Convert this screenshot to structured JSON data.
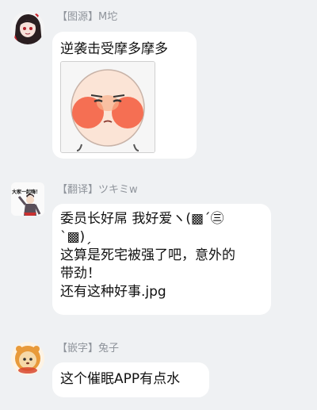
{
  "messages": [
    {
      "sender": "【图源】M坨",
      "lines": [
        "逆袭击受摩多摩多"
      ],
      "sticker_icon": "blushing-face-sticker",
      "avatar_icon": "anime-girl-avatar"
    },
    {
      "sender": "【翻译】ツキミw",
      "lines": [
        "委员长好屌 我好爱ヽ(▩ˊ㊂",
        "`▩)ˏ",
        "这算是死宅被强了吧，意外的",
        "带劲！",
        "还有这种好事.jpg"
      ],
      "avatar_icon": "cheering-figure-avatar",
      "avatar_caption": "大家一起嗨！"
    },
    {
      "sender": "【嵌字】兔子",
      "lines": [
        "这个催眠APP有点水"
      ],
      "avatar_icon": "lion-cub-avatar"
    }
  ]
}
